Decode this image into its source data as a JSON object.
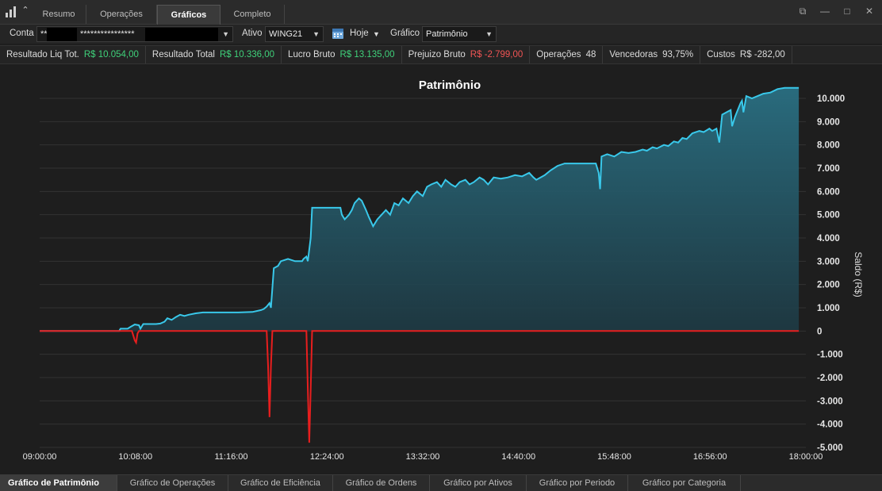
{
  "tabs": [
    {
      "label": "Resumo",
      "active": false
    },
    {
      "label": "Operações",
      "active": false
    },
    {
      "label": "Gráficos",
      "active": true
    },
    {
      "label": "Completo",
      "active": false
    }
  ],
  "filters": {
    "conta_label": "Conta",
    "conta_value": "**",
    "conta_masked": "****************",
    "ativo_label": "Ativo",
    "ativo_value": "WING21",
    "periodo_value": "Hoje",
    "grafico_label": "Gráfico",
    "grafico_value": "Patrimônio"
  },
  "stats": [
    {
      "label": "Resultado Liq Tot.",
      "value": "R$ 10.054,00",
      "tone": "pos"
    },
    {
      "label": "Resultado Total",
      "value": "R$ 10.336,00",
      "tone": "pos"
    },
    {
      "label": "Lucro Bruto",
      "value": "R$ 13.135,00",
      "tone": "pos"
    },
    {
      "label": "Prejuizo Bruto",
      "value": "R$ -2.799,00",
      "tone": "neg"
    },
    {
      "label": "Operações",
      "value": "48",
      "tone": "neu"
    },
    {
      "label": "Vencedoras",
      "value": "93,75%",
      "tone": "neu"
    },
    {
      "label": "Custos",
      "value": "R$ -282,00",
      "tone": "neu"
    }
  ],
  "bottom_tabs": [
    {
      "label": "Gráfico de Patrimônio",
      "active": true
    },
    {
      "label": "Gráfico de Operações",
      "active": false
    },
    {
      "label": "Gráfico de Eficiência",
      "active": false
    },
    {
      "label": "Gráfico de Ordens",
      "active": false
    },
    {
      "label": "Gráfico por Ativos",
      "active": false
    },
    {
      "label": "Gráfico por Periodo",
      "active": false
    },
    {
      "label": "Gráfico por Categoria",
      "active": false
    }
  ],
  "colors": {
    "positive": "#3fd17a",
    "negative": "#f05454",
    "line": "#39c8ea",
    "drawdown": "#e81e1e",
    "area_top": "#2a6f82",
    "area_bottom": "#1e3a44"
  },
  "chart_data": {
    "type": "area",
    "title": "Patrimônio",
    "ylabel": "Saldo (R$)",
    "xlabel": "",
    "x_tick_labels": [
      "09:00:00",
      "10:08:00",
      "11:16:00",
      "12:24:00",
      "13:32:00",
      "14:40:00",
      "15:48:00",
      "16:56:00",
      "18:00:00"
    ],
    "y_tick_labels": [
      "10.000",
      "9.000",
      "8.000",
      "7.000",
      "6.000",
      "5.000",
      "4.000",
      "3.000",
      "2.000",
      "1.000",
      "0",
      "-1.000",
      "-2.000",
      "-3.000",
      "-4.000",
      "-5.000"
    ],
    "y_tick_values": [
      10000,
      9000,
      8000,
      7000,
      6000,
      5000,
      4000,
      3000,
      2000,
      1000,
      0,
      -1000,
      -2000,
      -3000,
      -4000,
      -5000
    ],
    "ylim": [
      -5000,
      10000
    ],
    "xlim_minutes": [
      540,
      1080
    ],
    "grid": true,
    "series": [
      {
        "points": [
          [
            540,
            0
          ],
          [
            596,
            0
          ],
          [
            597,
            100
          ],
          [
            602,
            100
          ],
          [
            604,
            180
          ],
          [
            607,
            280
          ],
          [
            610,
            250
          ],
          [
            611,
            100
          ],
          [
            613,
            300
          ],
          [
            617,
            300
          ],
          [
            622,
            300
          ],
          [
            625,
            320
          ],
          [
            628,
            400
          ],
          [
            630,
            550
          ],
          [
            633,
            480
          ],
          [
            636,
            600
          ],
          [
            639,
            700
          ],
          [
            642,
            650
          ],
          [
            645,
            700
          ],
          [
            650,
            760
          ],
          [
            655,
            800
          ],
          [
            660,
            800
          ],
          [
            670,
            800
          ],
          [
            680,
            800
          ],
          [
            690,
            820
          ],
          [
            696,
            900
          ],
          [
            698,
            950
          ],
          [
            700,
            1050
          ],
          [
            702,
            1200
          ],
          [
            703,
            1000
          ],
          [
            705,
            2700
          ],
          [
            708,
            2800
          ],
          [
            710,
            3000
          ],
          [
            715,
            3100
          ],
          [
            720,
            3000
          ],
          [
            725,
            3000
          ],
          [
            726,
            3100
          ],
          [
            728,
            3200
          ],
          [
            729,
            3000
          ],
          [
            731,
            4000
          ],
          [
            732,
            5300
          ],
          [
            745,
            5300
          ],
          [
            752,
            5300
          ],
          [
            753,
            5000
          ],
          [
            755,
            4800
          ],
          [
            758,
            5000
          ],
          [
            760,
            5200
          ],
          [
            762,
            5500
          ],
          [
            765,
            5700
          ],
          [
            767,
            5600
          ],
          [
            770,
            5200
          ],
          [
            772,
            4900
          ],
          [
            775,
            4500
          ],
          [
            778,
            4800
          ],
          [
            781,
            5000
          ],
          [
            784,
            5200
          ],
          [
            787,
            5000
          ],
          [
            790,
            5500
          ],
          [
            793,
            5400
          ],
          [
            796,
            5700
          ],
          [
            800,
            5500
          ],
          [
            803,
            5800
          ],
          [
            806,
            6000
          ],
          [
            810,
            5800
          ],
          [
            813,
            6200
          ],
          [
            816,
            6300
          ],
          [
            820,
            6400
          ],
          [
            823,
            6200
          ],
          [
            826,
            6500
          ],
          [
            830,
            6300
          ],
          [
            833,
            6200
          ],
          [
            836,
            6400
          ],
          [
            840,
            6500
          ],
          [
            843,
            6300
          ],
          [
            846,
            6400
          ],
          [
            850,
            6600
          ],
          [
            853,
            6500
          ],
          [
            856,
            6300
          ],
          [
            860,
            6600
          ],
          [
            865,
            6550
          ],
          [
            870,
            6600
          ],
          [
            875,
            6700
          ],
          [
            880,
            6650
          ],
          [
            885,
            6800
          ],
          [
            888,
            6600
          ],
          [
            890,
            6500
          ],
          [
            893,
            6600
          ],
          [
            896,
            6700
          ],
          [
            900,
            6900
          ],
          [
            905,
            7100
          ],
          [
            910,
            7200
          ],
          [
            920,
            7200
          ],
          [
            932,
            7200
          ],
          [
            934,
            6800
          ],
          [
            935,
            6100
          ],
          [
            936,
            7500
          ],
          [
            940,
            7600
          ],
          [
            945,
            7500
          ],
          [
            950,
            7700
          ],
          [
            955,
            7650
          ],
          [
            960,
            7700
          ],
          [
            965,
            7800
          ],
          [
            968,
            7750
          ],
          [
            972,
            7900
          ],
          [
            975,
            7850
          ],
          [
            980,
            8000
          ],
          [
            983,
            7950
          ],
          [
            987,
            8150
          ],
          [
            990,
            8100
          ],
          [
            993,
            8300
          ],
          [
            996,
            8250
          ],
          [
            1000,
            8500
          ],
          [
            1005,
            8600
          ],
          [
            1008,
            8550
          ],
          [
            1012,
            8700
          ],
          [
            1014,
            8600
          ],
          [
            1017,
            8700
          ],
          [
            1019,
            8100
          ],
          [
            1021,
            9300
          ],
          [
            1024,
            9400
          ],
          [
            1027,
            9500
          ],
          [
            1028,
            8800
          ],
          [
            1030,
            9200
          ],
          [
            1032,
            9500
          ],
          [
            1034,
            9800
          ],
          [
            1035,
            9900
          ],
          [
            1036,
            9400
          ],
          [
            1038,
            10100
          ],
          [
            1042,
            10000
          ],
          [
            1046,
            10100
          ],
          [
            1050,
            10200
          ],
          [
            1055,
            10250
          ],
          [
            1060,
            10400
          ],
          [
            1065,
            10450
          ],
          [
            1075,
            10450
          ]
        ]
      },
      {
        "points": [
          [
            540,
            0
          ],
          [
            605,
            0
          ],
          [
            606,
            -200
          ],
          [
            607,
            -400
          ],
          [
            608,
            -500
          ],
          [
            609,
            -100
          ],
          [
            610,
            0
          ],
          [
            700,
            0
          ],
          [
            701,
            -1500
          ],
          [
            702,
            -3700
          ],
          [
            703,
            -1500
          ],
          [
            704,
            0
          ],
          [
            728,
            0
          ],
          [
            729,
            -2500
          ],
          [
            730,
            -4800
          ],
          [
            731,
            -2500
          ],
          [
            732,
            0
          ],
          [
            1075,
            0
          ]
        ]
      }
    ]
  }
}
